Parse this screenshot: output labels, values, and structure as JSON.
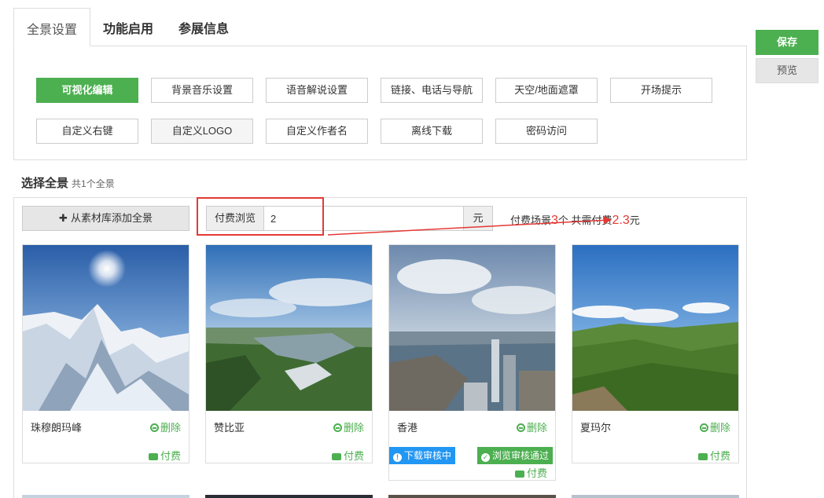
{
  "tabs": [
    {
      "label": "全景设置",
      "active": true
    },
    {
      "label": "功能启用",
      "active": false
    },
    {
      "label": "参展信息",
      "active": false
    }
  ],
  "features": {
    "row1": [
      "可视化编辑",
      "背景音乐设置",
      "语音解说设置",
      "链接、电话与导航",
      "天空/地面遮罩",
      "开场提示"
    ],
    "row2": [
      "自定义右键",
      "自定义LOGO",
      "自定义作者名",
      "离线下载",
      "密码访问"
    ]
  },
  "side": {
    "save_label": "保存",
    "preview_label": "预览"
  },
  "section": {
    "title": "选择全景",
    "subtitle": "共1个全景"
  },
  "toolbar": {
    "add_label": "从素材库添加全景",
    "pay_label": "付费浏览",
    "pay_value": "2",
    "pay_unit": "元"
  },
  "summary": {
    "prefix": "付费场景",
    "scene_count": "3",
    "middle": "个 共需付费",
    "amount": "2.3",
    "suffix": "元"
  },
  "cards": [
    {
      "name": "珠穆朗玛峰",
      "delete_label": "删除",
      "pay_label": "付费"
    },
    {
      "name": "赞比亚",
      "delete_label": "删除",
      "pay_label": "付费"
    },
    {
      "name": "香港",
      "delete_label": "删除",
      "pay_label": "付费",
      "badges": [
        "下载审核中",
        "浏览审核通过"
      ]
    },
    {
      "name": "夏玛尔",
      "delete_label": "删除",
      "pay_label": "付费"
    }
  ],
  "colors": {
    "accent": "#4caf50",
    "info": "#2196f3",
    "alert": "#e53935"
  }
}
